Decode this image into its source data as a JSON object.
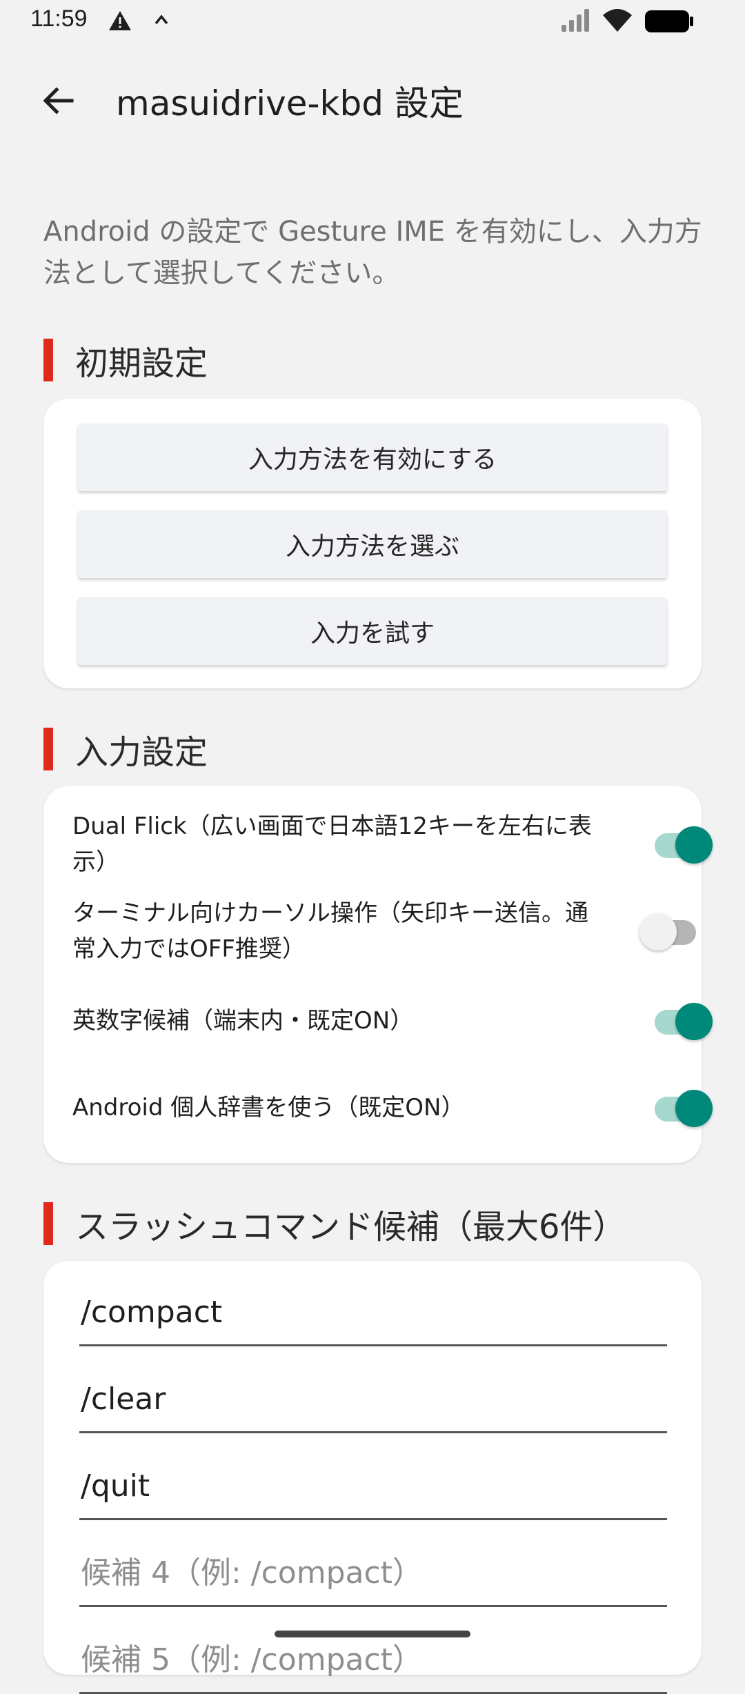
{
  "status_bar": {
    "time": "11:59",
    "icons": [
      "warning-icon",
      "caret-up-icon",
      "signal-icon",
      "wifi-icon",
      "battery-icon"
    ]
  },
  "app_bar": {
    "title": "masuidrive-kbd 設定",
    "back_icon": "arrow-left-icon"
  },
  "description": "Android の設定で Gesture IME を有効にし、入力方法として選択してください。",
  "sections": {
    "initial": {
      "title": "初期設定",
      "buttons": [
        {
          "label": "入力方法を有効にする"
        },
        {
          "label": "入力方法を選ぶ"
        },
        {
          "label": "入力を試す"
        }
      ]
    },
    "input": {
      "title": "入力設定",
      "settings": [
        {
          "label": "Dual Flick（広い画面で日本語12キーを左右に表示）",
          "on": true
        },
        {
          "label": "ターミナル向けカーソル操作（矢印キー送信。通常入力ではOFF推奨）",
          "on": false
        },
        {
          "label": "英数字候補（端末内・既定ON）",
          "on": true
        },
        {
          "label": "Android 個人辞書を使う（既定ON）",
          "on": true
        }
      ]
    },
    "commands": {
      "title": "スラッシュコマンド候補（最大6件）",
      "fields": [
        {
          "value": "/compact",
          "placeholder": ""
        },
        {
          "value": "/clear",
          "placeholder": ""
        },
        {
          "value": "/quit",
          "placeholder": ""
        },
        {
          "value": "",
          "placeholder": "候補 4（例: /compact）"
        },
        {
          "value": "",
          "placeholder": "候補 5（例: /compact）"
        }
      ]
    }
  },
  "colors": {
    "accent_bar": "#e0281c",
    "toggle_on": "#00897b",
    "background": "#f2f2f2"
  }
}
